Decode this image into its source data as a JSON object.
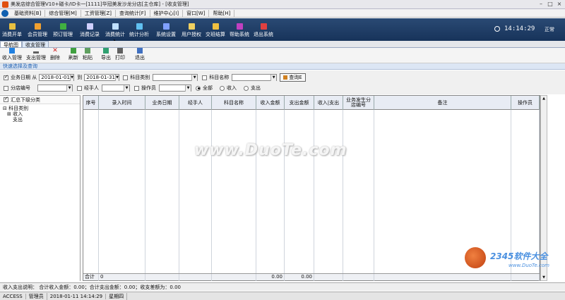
{
  "window": {
    "title": "美发店综合管理V10+磁卡/ID卡一[1111]华冠美发沙龙分店[主仓库] - [收支管理]"
  },
  "menu": {
    "items": [
      "基础资料[B]",
      "综合管理[M]",
      "工资管理[Z]",
      "查询统计[F]",
      "维护中心[I]",
      "窗口[W]",
      "帮助[H]"
    ]
  },
  "toolbar": {
    "items": [
      "消费开单",
      "会员管理",
      "预订管理",
      "消费记录",
      "消费统计",
      "统计分析",
      "系统设置",
      "用户授权",
      "交班结算",
      "帮助系统",
      "退出系统"
    ],
    "clock": "14:14:29",
    "status": "正常"
  },
  "tabs": [
    "导航图",
    "收支管理"
  ],
  "subtoolbar": {
    "items": [
      "收入管理",
      "支出管理",
      "删除",
      "刷新",
      "粘贴",
      "导出",
      "打印",
      "退出"
    ]
  },
  "quicksearch": "快速选择及查询",
  "filters": {
    "date_label": "业务日期 从",
    "date_from": "2018-01-01",
    "to_label": "到",
    "date_to": "2018-01-31",
    "category_label": "科目类别",
    "subject_label": "科目名称",
    "query_button": "查询E",
    "branch_label": "分店编号",
    "handler_label": "经手人",
    "operator_label": "操作员",
    "radio_all": "全部",
    "radio_income": "收入",
    "radio_expense": "支出"
  },
  "leftpanel": {
    "summary_label": "汇总下级分类",
    "tree": [
      "科目类别",
      "收入",
      "支出"
    ]
  },
  "grid": {
    "columns": [
      "序号",
      "录入时间",
      "业务日期",
      "经手人",
      "科目名称",
      "收入金额",
      "支出金额",
      "收入|支出",
      "业务发生分店编号",
      "备注",
      "操作员"
    ],
    "footer_label": "合计",
    "footer_count": "0",
    "footer_income": "0.00",
    "footer_expense": "0.00"
  },
  "summary": "收入支出说明：    合计收入金额：0.00；合计支出金额：0.00；收支差额为：0.00",
  "statusbar": {
    "db": "ACCESS",
    "user": "管理员",
    "datetime": "2018-01-11 14:14:29",
    "weekday": "星期四"
  },
  "watermark": {
    "main": "www.DuoTe.com",
    "logo": "2345软件大全",
    "logo_url": "www.DuoTe.com"
  },
  "colors": {
    "toolbar_bg": "#1d3a63",
    "grid_header": "#e8ecf4"
  }
}
